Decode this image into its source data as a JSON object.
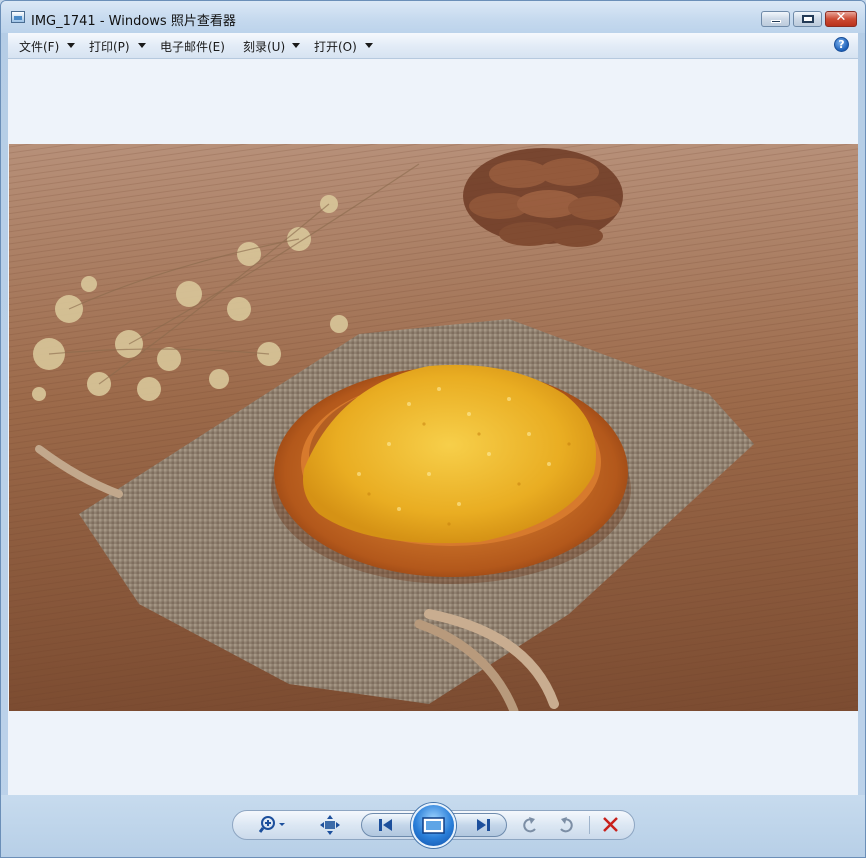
{
  "window": {
    "title": "IMG_1741 - Windows 照片查看器",
    "icon": "photo-viewer-icon",
    "controls": [
      "minimize-icon",
      "maximize-icon",
      "close-icon"
    ]
  },
  "menu": {
    "items": [
      {
        "label": "文件(F)",
        "has_dropdown": true
      },
      {
        "label": "打印(P)",
        "has_dropdown": true
      },
      {
        "label": "电子邮件(E)",
        "has_dropdown": false
      },
      {
        "label": "刻录(U)",
        "has_dropdown": true
      },
      {
        "label": "打开(O)",
        "has_dropdown": true
      }
    ],
    "help_glyph": "?"
  },
  "image": {
    "description_icon": "photo-millet-bowl"
  },
  "toolbar": {
    "buttons": [
      "zoom-icon",
      "fit-to-window-icon",
      "previous-icon",
      "slideshow-icon",
      "next-icon",
      "rotate-counterclockwise-icon",
      "rotate-clockwise-icon",
      "delete-icon"
    ],
    "colors": {
      "delete": "#c8201b",
      "accent": "#2a7fd9"
    }
  }
}
